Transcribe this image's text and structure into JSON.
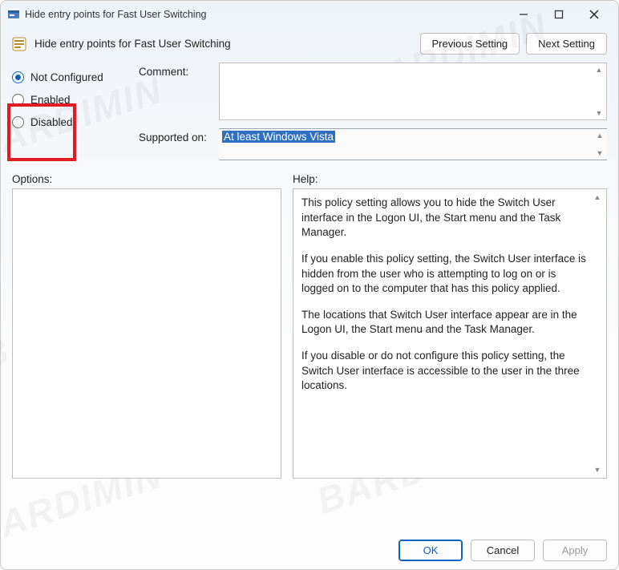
{
  "window": {
    "title": "Hide entry points for Fast User Switching"
  },
  "header": {
    "policy_title": "Hide entry points for Fast User Switching",
    "prev_btn": "Previous Setting",
    "next_btn": "Next Setting"
  },
  "radios": {
    "not_configured": "Not Configured",
    "enabled": "Enabled",
    "disabled": "Disabled",
    "selected": "not_configured"
  },
  "labels": {
    "comment": "Comment:",
    "supported_on": "Supported on:",
    "options": "Options:",
    "help": "Help:"
  },
  "comment_value": "",
  "supported_value": "At least Windows Vista",
  "help_paragraphs": [
    "This policy setting allows you to hide the Switch User interface in the Logon UI, the Start menu and the Task Manager.",
    "If you enable this policy setting, the Switch User interface is hidden from the user who is attempting to log on or is logged on to the computer that has this policy applied.",
    "The locations that Switch User interface appear are in the Logon UI, the Start menu and the Task Manager.",
    "If you disable or do not configure this policy setting, the Switch User interface is accessible to the user in the three locations."
  ],
  "footer": {
    "ok": "OK",
    "cancel": "Cancel",
    "apply": "Apply"
  },
  "watermark": "BARDIMIN"
}
